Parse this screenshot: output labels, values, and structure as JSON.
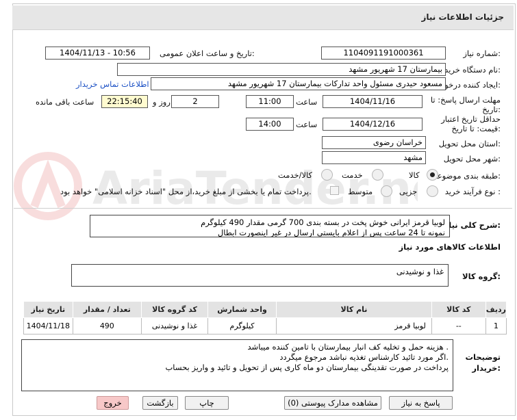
{
  "title": "جزئیات اطلاعات نیاز",
  "fields": {
    "need_number_label": "شماره نیاز:",
    "need_number": "1104091191000361",
    "announce_label": "تاریخ و ساعت اعلان عمومی:",
    "announce_value": "1404/11/13 - 10:56",
    "buyer_org_label": "نام دستگاه خریدار:",
    "buyer_org": "بیمارستان 17 شهریور مشهد",
    "creator_label": "ایجاد کننده درخواست:",
    "creator": "مسعود حیدری مسئول واحد تدارکات  بیمارستان 17 شهریور مشهد",
    "contact_link": "اطلاعات تماس خریدار",
    "deadline_label": "مهلت ارسال پاسخ: تا تاریخ:",
    "deadline_date": "1404/11/16",
    "time_label": "ساعت",
    "deadline_time": "11:00",
    "days_value": "2",
    "days_label": "روز و",
    "remaining_time": "22:15:40",
    "remaining_label": "ساعت باقی مانده",
    "validity_label": "حداقل تاریخ اعتبار قیمت: تا تاریخ:",
    "validity_date": "1404/12/16",
    "validity_time": "14:00",
    "province_label": "استان محل تحویل:",
    "province": "خراسان رضوی",
    "city_label": "شهر محل تحویل:",
    "city": "مشهد",
    "category_label": "طبقه بندی موضوعی:",
    "category_options": [
      "کالا",
      "خدمت",
      "کالا/خدمت"
    ],
    "category_selected": "کالا",
    "process_label": "نوع فرآیند خرید :",
    "process_options": [
      "جزیی",
      "متوسط"
    ],
    "payment_note": "پرداخت تمام یا بخشی از مبلغ خرید،از محل \"اسناد خزانه اسلامی\" خواهد بود."
  },
  "description": {
    "label": "شرح کلی نیاز:",
    "text": "لوبیا قرمز ایرانی خوش پخت در بسته بندی 700 گرمی مقدار 490 کیلوگرم\nنمونه تا 24 ساعت پس از اعلام بایستی ارسال در غیر اینصورت ابطال"
  },
  "goods": {
    "section_title": "اطلاعات کالاهای مورد نیاز",
    "group_label": "گروه کالا:",
    "group_value": "غذا و نوشیدنی",
    "columns": [
      "ردیف",
      "کد کالا",
      "نام کالا",
      "واحد شمارش",
      "کد گروه کالا",
      "تعداد / مقدار",
      "تاریخ نیاز"
    ],
    "rows": [
      [
        "1",
        "--",
        "لوبیا قرمز",
        "کیلوگرم",
        "غذا و نوشیدنی",
        "490",
        "1404/11/18"
      ]
    ]
  },
  "buyer_notes": {
    "label": "توضیحات خریدار:",
    "text": "هزینه حمل و تخلیه کف انبار بیمارستان با تامین کننده میباشد .\nاگر مورد تائید کارشناس تغذیه نباشد مرجوع میگردد.\nپرداخت در صورت تقدینگی بیمارستان دو ماه کاری پس از تحویل و تائید و واریز بحساب"
  },
  "buttons": {
    "reply": "پاسخ به نیاز",
    "attachments": "مشاهده مدارک پیوستی (0)",
    "print": "چاپ",
    "back": "بازگشت",
    "exit": "خروج"
  },
  "watermark_text": "AriaTender.neT",
  "colors": {
    "link": "#1a4fc4",
    "highlight": "#fffbd0",
    "exit_button": "#f7c8c8",
    "header_bg": "#e6e6e6"
  }
}
